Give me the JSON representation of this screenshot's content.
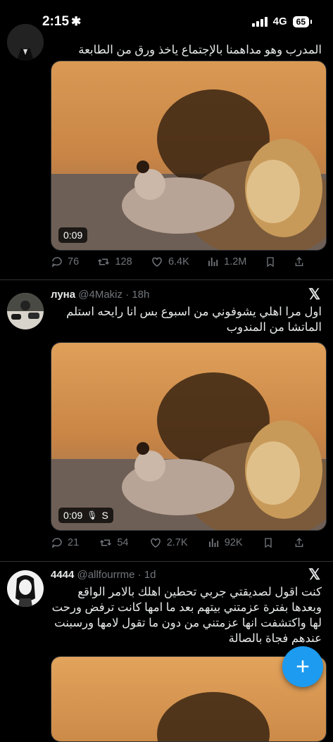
{
  "status": {
    "time": "2:15",
    "network": "4G",
    "battery": "65"
  },
  "tweets": [
    {
      "text_lines": [
        "المدرب وهو مداهمنا بالإجتماع ياخذ ورق من الطابعة"
      ],
      "video_duration": "0:09",
      "actions": {
        "replies": "76",
        "retweets": "128",
        "likes": "6.4K",
        "views": "1.2M"
      }
    },
    {
      "name": "луна",
      "handle": "@4Makiz",
      "time": "18h",
      "text_lines": [
        "اول مرا اهلي يشوفوني من اسبوع  بس انا رايحه استلم",
        "الماتشا  من المندوب"
      ],
      "video_duration": "0:09",
      "video_extra": "S",
      "actions": {
        "replies": "21",
        "retweets": "54",
        "likes": "2.7K",
        "views": "92K"
      }
    },
    {
      "name": "4444",
      "handle": "@allfourrme",
      "time": "1d",
      "text_lines": [
        "كنت اقول لصديقتي جربي تحطين اهلك بالامر الواقع",
        "وبعدها بفترة عزمتني بيتهم بعد ما امها كانت ترفض ورحت",
        "لها واكتشفت انها عزمتني من دون ما تقول لامها ورسبنت",
        "عندهم فجاة بالصالة"
      ]
    }
  ],
  "fab": {
    "label": "+"
  }
}
